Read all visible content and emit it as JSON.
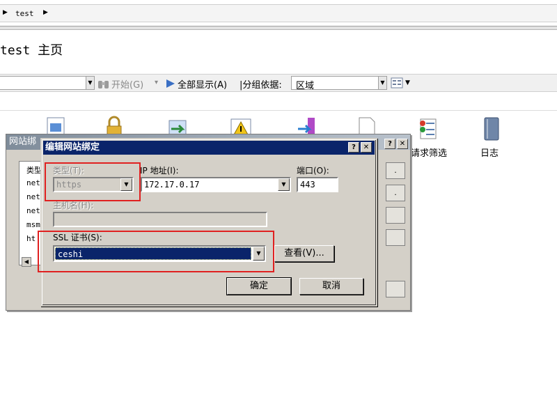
{
  "breadcrumb": {
    "item": "test"
  },
  "page": {
    "title": "test 主页"
  },
  "toolbar": {
    "start": "开始(G)",
    "show_all": "全部显示(A)",
    "group_by_label": "|分组依据:",
    "group_by_value": "区域"
  },
  "features": [
    {
      "label": "请求筛选",
      "icon": "request-filter-icon"
    },
    {
      "label": "日志",
      "icon": "log-icon"
    }
  ],
  "bg_dialog": {
    "title": "网站绑",
    "column_header": "类型",
    "rows": [
      "net",
      "net",
      "net",
      "msm",
      "ht"
    ]
  },
  "dialog": {
    "title": "编辑网站绑定",
    "type_label": "类型(T):",
    "type_value": "https",
    "ip_label": "IP 地址(I):",
    "ip_value": "172.17.0.17",
    "port_label": "端口(O):",
    "port_value": "443",
    "host_label": "主机名(H):",
    "host_value": "",
    "ssl_label": "SSL 证书(S):",
    "ssl_value": "ceshi",
    "view_button": "查看(V)...",
    "ok_button": "确定",
    "cancel_button": "取消",
    "help_glyph": "?",
    "close_glyph": "✕"
  },
  "colors": {
    "dialog_title": "#0a246a",
    "highlight": "#e02020",
    "dialog_face": "#d4d0c8"
  }
}
